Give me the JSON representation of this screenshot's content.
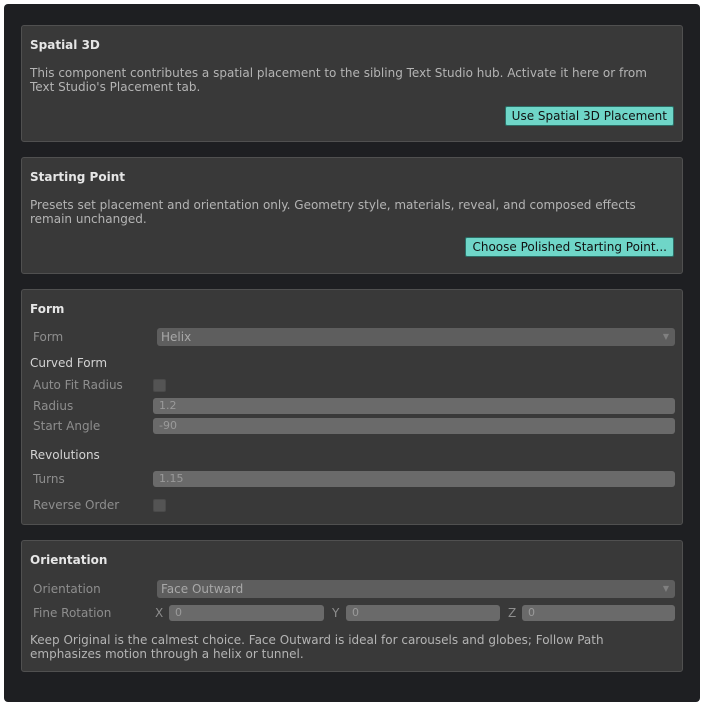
{
  "spatial": {
    "title": "Spatial 3D",
    "description": "This component contributes a spatial placement to the sibling Text Studio hub. Activate it here or from Text Studio's Placement tab.",
    "button": "Use Spatial 3D Placement"
  },
  "starting_point": {
    "title": "Starting Point",
    "description": "Presets set placement and orientation only. Geometry style, materials, reveal, and composed effects remain unchanged.",
    "button": "Choose Polished Starting Point..."
  },
  "form": {
    "title": "Form",
    "form_label": "Form",
    "form_value": "Helix",
    "curved_header": "Curved Form",
    "auto_fit_label": "Auto Fit Radius",
    "auto_fit_checked": false,
    "radius_label": "Radius",
    "radius_value": "1.2",
    "start_angle_label": "Start Angle",
    "start_angle_value": "-90",
    "revolutions_header": "Revolutions",
    "turns_label": "Turns",
    "turns_value": "1.15",
    "reverse_label": "Reverse Order",
    "reverse_checked": false
  },
  "orientation": {
    "title": "Orientation",
    "orientation_label": "Orientation",
    "orientation_value": "Face Outward",
    "fine_label": "Fine Rotation",
    "x_label": "X",
    "x_value": "0",
    "y_label": "Y",
    "y_value": "0",
    "z_label": "Z",
    "z_value": "0",
    "note": "Keep Original is the calmest choice. Face Outward is ideal for carousels and globes; Follow Path emphasizes motion through a helix or tunnel."
  },
  "colors": {
    "accent": "#6fd6c8",
    "panel": "#393939",
    "background": "#1e1f22"
  },
  "icons": {
    "dropdown": "chevron-down-icon"
  }
}
